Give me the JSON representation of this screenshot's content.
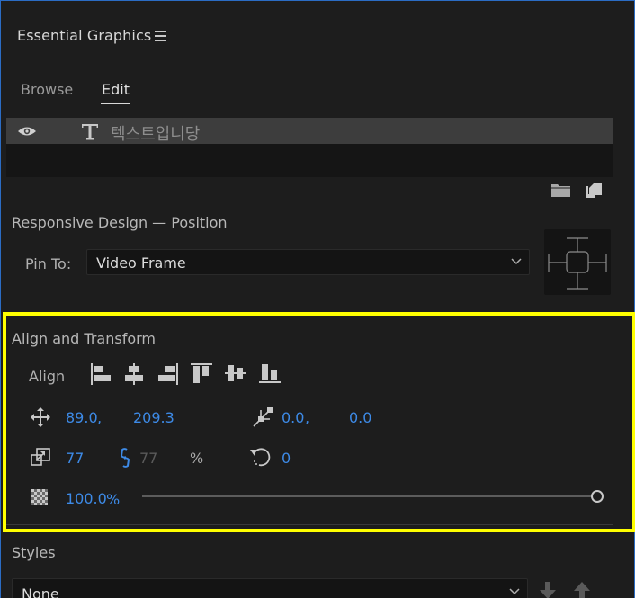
{
  "panel": {
    "title": "Essential Graphics",
    "tabs": [
      {
        "label": "Browse",
        "active": false
      },
      {
        "label": "Edit",
        "active": true
      }
    ]
  },
  "layers": [
    {
      "type": "text",
      "name": "텍스트입니당",
      "visible": true,
      "selected": true
    }
  ],
  "responsive": {
    "title": "Responsive Design — Position",
    "pin_label": "Pin To:",
    "pin_value": "Video Frame"
  },
  "align": {
    "title": "Align and Transform",
    "align_label": "Align",
    "position_x": "89.0",
    "position_y": "209.3",
    "anchor_x": "0.0",
    "anchor_y": "0.0",
    "scale": "77",
    "scale_linked": "77",
    "scale_unit": "%",
    "rotation": "0",
    "opacity": "100.0",
    "opacity_unit": "%",
    "opacity_fraction": 1.0,
    "separator": ","
  },
  "styles": {
    "title": "Styles",
    "value": "None"
  },
  "colors": {
    "accent": "#3d8ae6",
    "highlight": "#ffff00",
    "panel_border": "#2b6cc4"
  }
}
